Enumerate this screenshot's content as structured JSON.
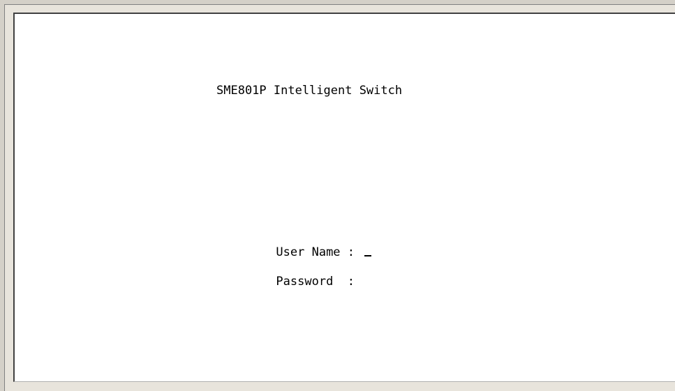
{
  "terminal": {
    "title": "SME801P Intelligent Switch",
    "login": {
      "username_label": "User Name",
      "username_separator": ":",
      "password_label": "Password",
      "password_separator": ":",
      "username_value": "",
      "password_value": ""
    }
  }
}
